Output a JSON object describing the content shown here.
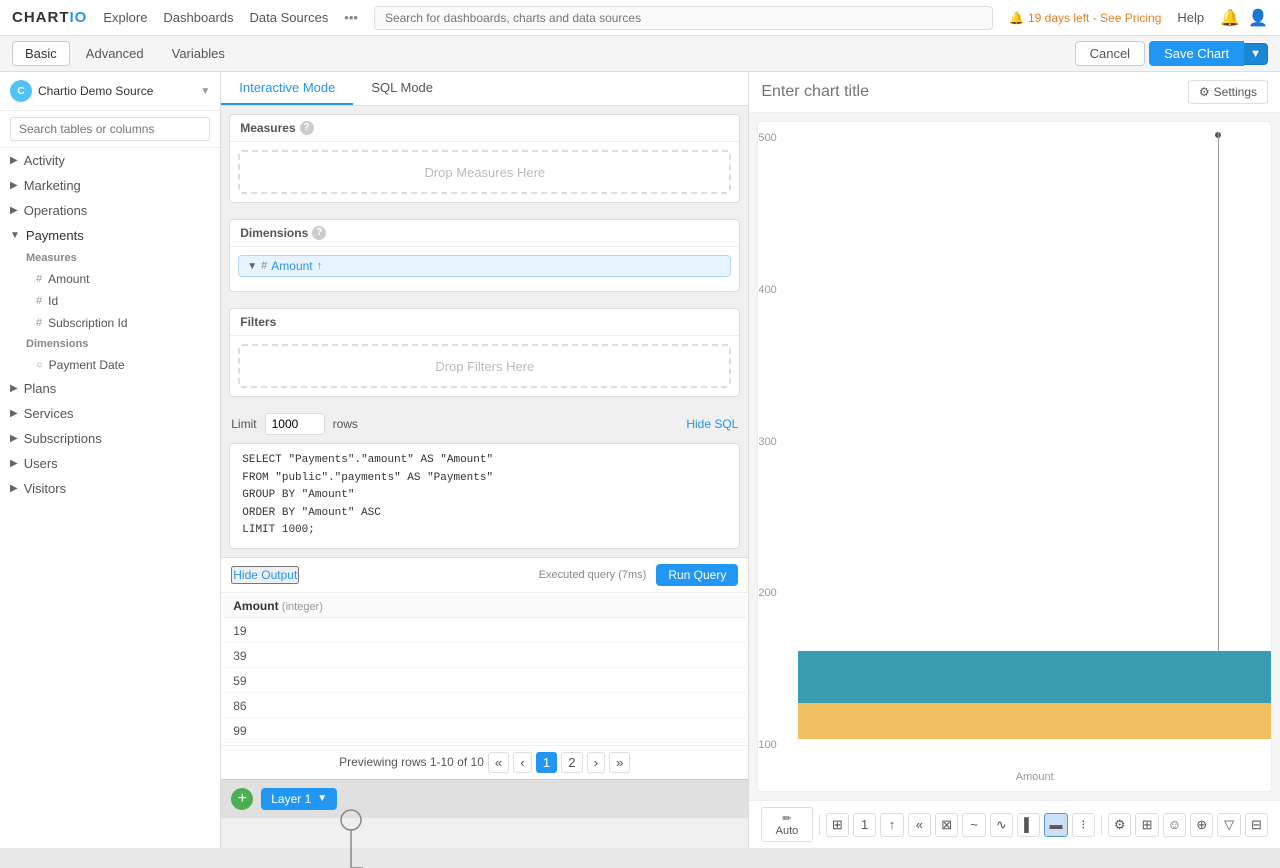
{
  "topnav": {
    "logo": "CHARTIO",
    "links": [
      "Explore",
      "Dashboards",
      "Data Sources"
    ],
    "search_placeholder": "Search for dashboards, charts and data sources",
    "alert": "19 days left - See Pricing",
    "help": "Help"
  },
  "subnav": {
    "tabs": [
      "Basic",
      "Advanced",
      "Variables"
    ],
    "active_tab": "Basic",
    "cancel_label": "Cancel",
    "save_label": "Save Chart"
  },
  "sidebar": {
    "source_name": "Chartio Demo Source",
    "source_initial": "C",
    "search_placeholder": "Search tables or columns",
    "tree": [
      {
        "label": "Activity",
        "expanded": false
      },
      {
        "label": "Marketing",
        "expanded": false
      },
      {
        "label": "Operations",
        "expanded": false
      },
      {
        "label": "Payments",
        "expanded": true,
        "children": [
          {
            "section": "Measures",
            "items": [
              {
                "name": "Amount",
                "type": "#"
              },
              {
                "name": "Id",
                "type": "#"
              },
              {
                "name": "Subscription Id",
                "type": "#"
              }
            ]
          },
          {
            "section": "Dimensions",
            "items": [
              {
                "name": "Payment Date",
                "type": "o"
              }
            ]
          }
        ]
      },
      {
        "label": "Plans",
        "expanded": false
      },
      {
        "label": "Services",
        "expanded": false
      },
      {
        "label": "Subscriptions",
        "expanded": false
      },
      {
        "label": "Users",
        "expanded": false
      },
      {
        "label": "Visitors",
        "expanded": false
      }
    ]
  },
  "middle": {
    "mode_tabs": [
      "Interactive Mode",
      "SQL Mode"
    ],
    "active_mode": "Interactive Mode",
    "measures_label": "Measures",
    "dimensions_label": "Dimensions",
    "filters_label": "Filters",
    "drop_measures_placeholder": "Drop Measures Here",
    "drop_filters_placeholder": "Drop Filters Here",
    "dimension_item": "Amount",
    "limit_label": "Limit",
    "limit_value": "1000",
    "rows_label": "rows",
    "hide_sql_label": "Hide SQL",
    "sql_code": "SELECT \"Payments\".\"amount\" AS \"Amount\"\nFROM \"public\".\"payments\" AS \"Payments\"\nGROUP BY \"Amount\"\nORDER BY \"Amount\" ASC\nLIMIT 1000;"
  },
  "output": {
    "hide_output_label": "Hide Output",
    "status": "Executed query (7ms)",
    "run_query_label": "Run Query",
    "column_header": "Amount",
    "column_type": "(integer)",
    "rows": [
      "19",
      "39",
      "59",
      "86",
      "99"
    ],
    "pagination_text": "Previewing rows 1-10 of 10",
    "pages": [
      "1",
      "2"
    ]
  },
  "layer": {
    "add_icon": "+",
    "layer_name": "Layer 1"
  },
  "chart": {
    "title_placeholder": "Enter chart title",
    "settings_label": "Settings",
    "y_labels": [
      "500",
      "400",
      "300",
      "200",
      "100"
    ],
    "x_label": "Amount",
    "toolbar": {
      "auto_label": "Auto",
      "icons": [
        "⊞",
        "1",
        "↑",
        "«",
        "⊠",
        "~",
        "∿",
        "∥",
        "▐",
        "▤",
        "✦",
        "☺",
        "⊕",
        "▽",
        "⊞",
        "☰"
      ]
    }
  }
}
